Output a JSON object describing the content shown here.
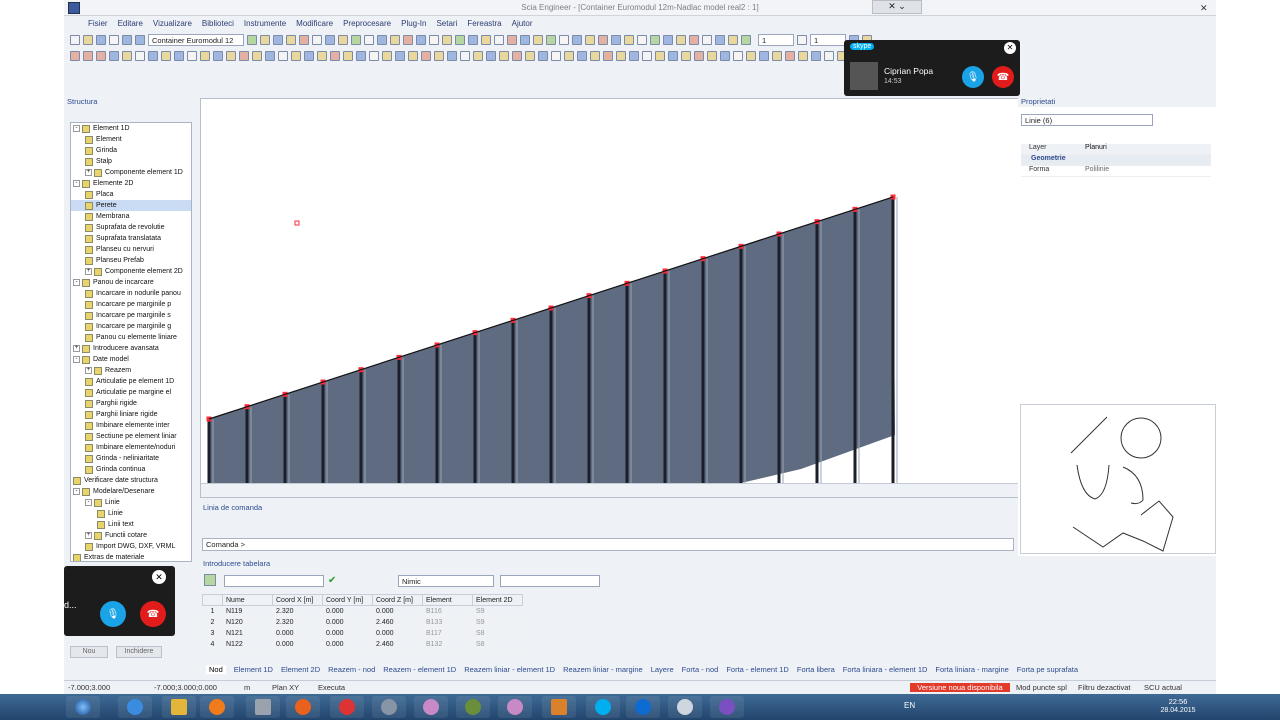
{
  "window": {
    "title": "Scia Engineer - [Container Euromodul 12m-Nadlac model real2 : 1]"
  },
  "menu": [
    "Fisier",
    "Editare",
    "Vizualizare",
    "Biblioteci",
    "Instrumente",
    "Modificare",
    "Preprocesare",
    "Plug-In",
    "Setari",
    "Fereastra",
    "Ajutor"
  ],
  "toolbar": {
    "project_combo": "Container Euromodul 12",
    "spin1": "1",
    "spin2": "1"
  },
  "structure": {
    "title": "Structura",
    "tree": [
      {
        "label": "Element 1D",
        "level": 0,
        "exp": "-"
      },
      {
        "label": "Element",
        "level": 1
      },
      {
        "label": "Grinda",
        "level": 1
      },
      {
        "label": "Stalp",
        "level": 1
      },
      {
        "label": "Componente element 1D",
        "level": 1,
        "exp": "+"
      },
      {
        "label": "Elemente 2D",
        "level": 0,
        "exp": "-"
      },
      {
        "label": "Placa",
        "level": 1
      },
      {
        "label": "Perete",
        "level": 1,
        "sel": true
      },
      {
        "label": "Membrana",
        "level": 1
      },
      {
        "label": "Suprafata de revolutie",
        "level": 1
      },
      {
        "label": "Suprafata translatata",
        "level": 1
      },
      {
        "label": "Planseu cu nervuri",
        "level": 1
      },
      {
        "label": "Planseu Prefab",
        "level": 1
      },
      {
        "label": "Componente element 2D",
        "level": 1,
        "exp": "+"
      },
      {
        "label": "Panou de incarcare",
        "level": 0,
        "exp": "-"
      },
      {
        "label": "Incarcare in nodurile panou",
        "level": 1
      },
      {
        "label": "Incarcare pe marginile p",
        "level": 1
      },
      {
        "label": "Incarcare pe marginile s",
        "level": 1
      },
      {
        "label": "Incarcare pe marginile g",
        "level": 1
      },
      {
        "label": "Panou cu elemente liniare",
        "level": 1
      },
      {
        "label": "Introducere avansata",
        "level": 0,
        "exp": "+"
      },
      {
        "label": "Date model",
        "level": 0,
        "exp": "-"
      },
      {
        "label": "Reazem",
        "level": 1,
        "exp": "+"
      },
      {
        "label": "Articulatie pe element 1D",
        "level": 1
      },
      {
        "label": "Articulatie pe margine el",
        "level": 1
      },
      {
        "label": "Parghii rigide",
        "level": 1
      },
      {
        "label": "Parghii liniare rigide",
        "level": 1
      },
      {
        "label": "Imbinare elemente inter",
        "level": 1
      },
      {
        "label": "Sectiune pe element liniar",
        "level": 1
      },
      {
        "label": "Imbinare elemente/noduri",
        "level": 1
      },
      {
        "label": "Grinda - neliniaritate",
        "level": 1
      },
      {
        "label": "Grinda continua",
        "level": 1
      },
      {
        "label": "Verificare date structura",
        "level": 0
      },
      {
        "label": "Modelare/Desenare",
        "level": 0,
        "exp": "-"
      },
      {
        "label": "Linie",
        "level": 1,
        "exp": "-"
      },
      {
        "label": "Linie",
        "level": 2
      },
      {
        "label": "Linii text",
        "level": 2
      },
      {
        "label": "Functii cotare",
        "level": 1,
        "exp": "+"
      },
      {
        "label": "Import DWG, DXF, VRML",
        "level": 1
      },
      {
        "label": "Extras de materiale",
        "level": 0
      }
    ],
    "btn_new": "Nou",
    "btn_close": "Inchidere"
  },
  "properties": {
    "title": "Proprietati",
    "selector": "Linie (6)",
    "layer_label": "Layer",
    "layer_value": "Planuri",
    "section": "Geometrie",
    "forma_label": "Forma",
    "forma_value": "Polilinie"
  },
  "command": {
    "title": "Linia de comanda",
    "prompt": "Comanda >"
  },
  "table": {
    "title": "Introducere tabelara",
    "filter": "Nimic",
    "columns": [
      "",
      "Nume",
      "Coord X [m]",
      "Coord Y [m]",
      "Coord Z [m]",
      "Element",
      "Element 2D"
    ],
    "rows": [
      [
        "1",
        "N119",
        "2.320",
        "0.000",
        "0.000",
        "B116",
        "S9"
      ],
      [
        "2",
        "N120",
        "2.320",
        "0.000",
        "2.460",
        "B133",
        "S9"
      ],
      [
        "3",
        "N121",
        "0.000",
        "0.000",
        "0.000",
        "B117",
        "S8"
      ],
      [
        "4",
        "N122",
        "0.000",
        "0.000",
        "2.460",
        "B132",
        "S8"
      ]
    ]
  },
  "bottom_tabs": [
    "Nod",
    "Element 1D",
    "Element 2D",
    "Reazem - nod",
    "Reazem - element 1D",
    "Reazem liniar - element 1D",
    "Reazem liniar - margine",
    "Layere",
    "Forta - nod",
    "Forta - element 1D",
    "Forta libera",
    "Forta liniara - element 1D",
    "Forta liniara - margine",
    "Forta pe suprafata"
  ],
  "status": {
    "coord1": "-7.000;3.000",
    "coord2": "-7.000;3.000;0.000",
    "unit": "m",
    "plane": "Plan XY",
    "mode": "Executa",
    "version_alert": "Versiune noua disponibila",
    "snap": "Mod puncte spl",
    "filter": "Filtru dezactivat",
    "ucs": "SCU actual"
  },
  "skype": {
    "brand": "skype",
    "caller": "Ciprian Popa",
    "duration": "14:53",
    "partial": "d..."
  },
  "taskbar": {
    "lang": "EN",
    "time": "22:56",
    "date": "28.04.2015"
  },
  "colors": {
    "accent": "#2d4b8e",
    "panel": "#5f6b80",
    "node": "#ff2a3a",
    "alert": "#e23b2b"
  }
}
